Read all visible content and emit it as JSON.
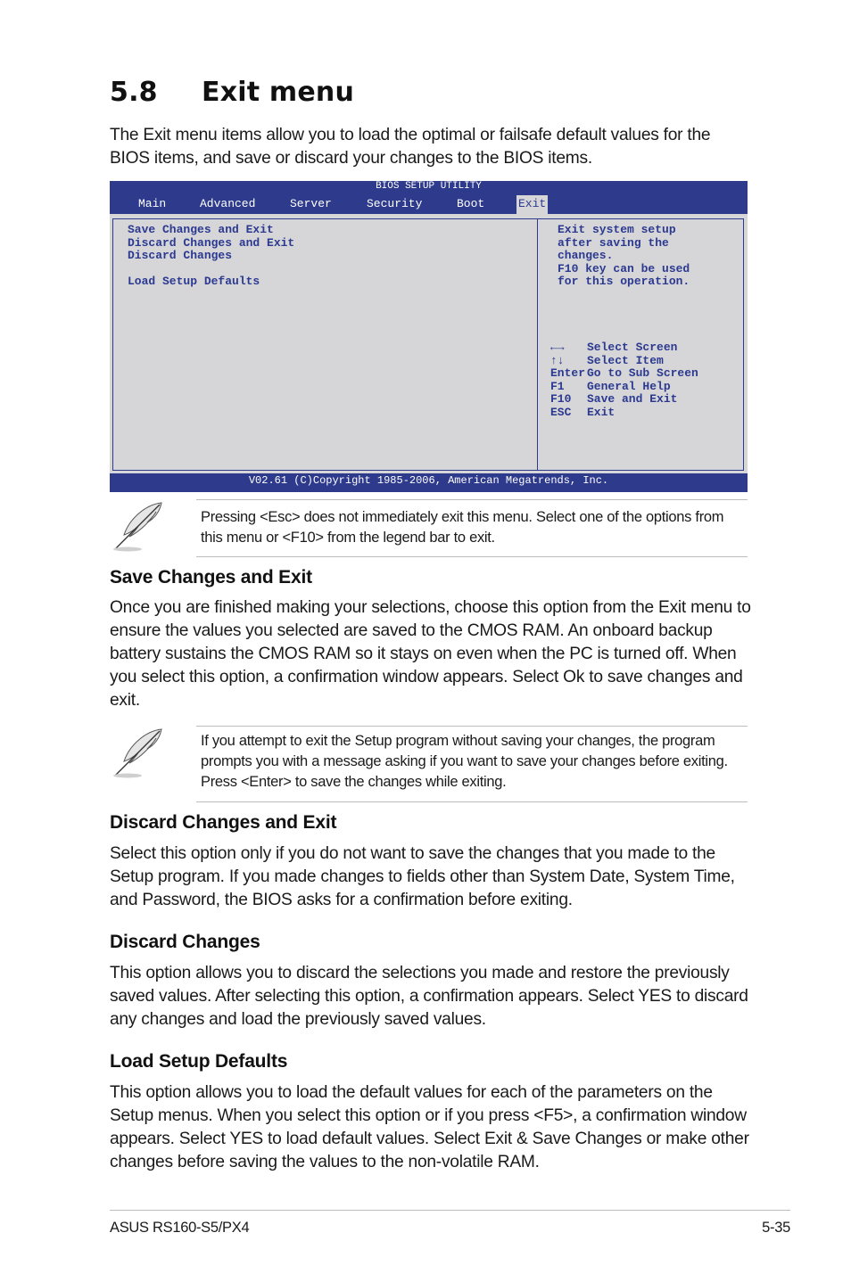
{
  "section": {
    "number": "5.8",
    "title": "Exit menu",
    "intro": "The Exit menu items allow you to load the optimal or failsafe default values for the BIOS items, and save or discard your changes to the BIOS items."
  },
  "bios": {
    "title": "BIOS SETUP UTILITY",
    "tabs": [
      {
        "label": "Main",
        "active": false
      },
      {
        "label": "Advanced",
        "active": false
      },
      {
        "label": "Server",
        "active": false
      },
      {
        "label": "Security",
        "active": false
      },
      {
        "label": "Boot",
        "active": false
      },
      {
        "label": "Exit",
        "active": true
      }
    ],
    "menu_items": [
      "Save Changes and Exit",
      "Discard Changes and Exit",
      "Discard Changes",
      "",
      "Load Setup Defaults"
    ],
    "help_lines": [
      "Exit system setup",
      "after saving the",
      "changes.",
      "F10 key can be used",
      "for this operation."
    ],
    "legend": [
      {
        "key": "←→",
        "action": "Select Screen"
      },
      {
        "key": "↑↓",
        "action": "Select Item"
      },
      {
        "key": "Enter",
        "action": "Go to Sub Screen"
      },
      {
        "key": "F1",
        "action": "General Help"
      },
      {
        "key": "F10",
        "action": "Save and Exit"
      },
      {
        "key": "ESC",
        "action": "Exit"
      }
    ],
    "copyright": "V02.61 (C)Copyright 1985-2006, American Megatrends, Inc.",
    "colors": {
      "bar": "#2e3a8c",
      "panel": "#d6d6d8",
      "text": "#2b3990"
    }
  },
  "notes": [
    {
      "icon": "feather-pen-icon",
      "text": "Pressing <Esc> does not immediately exit this menu. Select one of the options from this menu or <F10> from the legend bar to exit."
    },
    {
      "icon": "feather-pen-icon",
      "text": "If you attempt to exit the Setup program without saving your changes, the program prompts you with a message asking if you want to save your changes before exiting. Press <Enter> to save the changes while exiting."
    }
  ],
  "subsections": [
    {
      "heading": "Save Changes and Exit",
      "body": "Once you are finished making your selections, choose this option from the Exit menu to ensure the values you selected are saved to the CMOS RAM. An onboard backup battery sustains the CMOS RAM so it stays on even when the PC is turned off. When you select this option, a confirmation window appears. Select Ok to save changes and exit."
    },
    {
      "heading": "Discard Changes and Exit",
      "body": "Select this option only if you do not want to save the changes that you  made to the Setup program. If you made changes to fields other than System Date, System Time, and Password, the BIOS asks for a confirmation before exiting."
    },
    {
      "heading": "Discard Changes",
      "body": "This option allows you to discard the selections you made and restore the previously saved values. After selecting this option, a confirmation appears. Select YES to discard any changes and load the previously saved values."
    },
    {
      "heading": "Load Setup Defaults",
      "body": "This option allows you to load the default values for each of the parameters on the Setup menus. When you select this option or if you press <F5>, a confirmation window appears. Select YES to load default values. Select Exit & Save Changes or make other changes before saving the values to the non-volatile RAM."
    }
  ],
  "footer": {
    "product": "ASUS RS160-S5/PX4",
    "page": "5-35"
  }
}
